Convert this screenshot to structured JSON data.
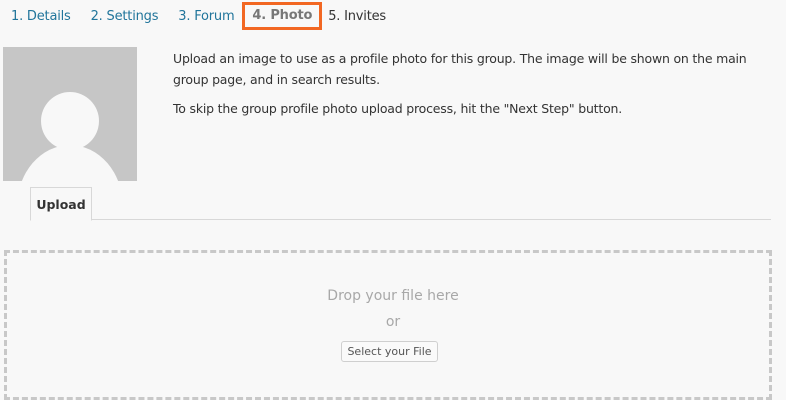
{
  "steps": [
    {
      "label": "1. Details"
    },
    {
      "label": "2. Settings"
    },
    {
      "label": "3. Forum"
    },
    {
      "label": "4. Photo"
    },
    {
      "label": "5. Invites"
    }
  ],
  "avatar": {
    "icon": "default-avatar-icon",
    "background": "#c6c6c6"
  },
  "description": {
    "paragraph1": "Upload an image to use as a profile photo for this group. The image will be shown on the main group page, and in search results.",
    "paragraph2": "To skip the group profile photo upload process, hit the \"Next Step\" button."
  },
  "tabs": {
    "upload": "Upload"
  },
  "dropzone": {
    "title": "Drop your file here",
    "or": "or",
    "button": "Select your File"
  },
  "colors": {
    "link": "#21759b",
    "active_step_border": "#f26722",
    "background": "#f8f8f8"
  }
}
